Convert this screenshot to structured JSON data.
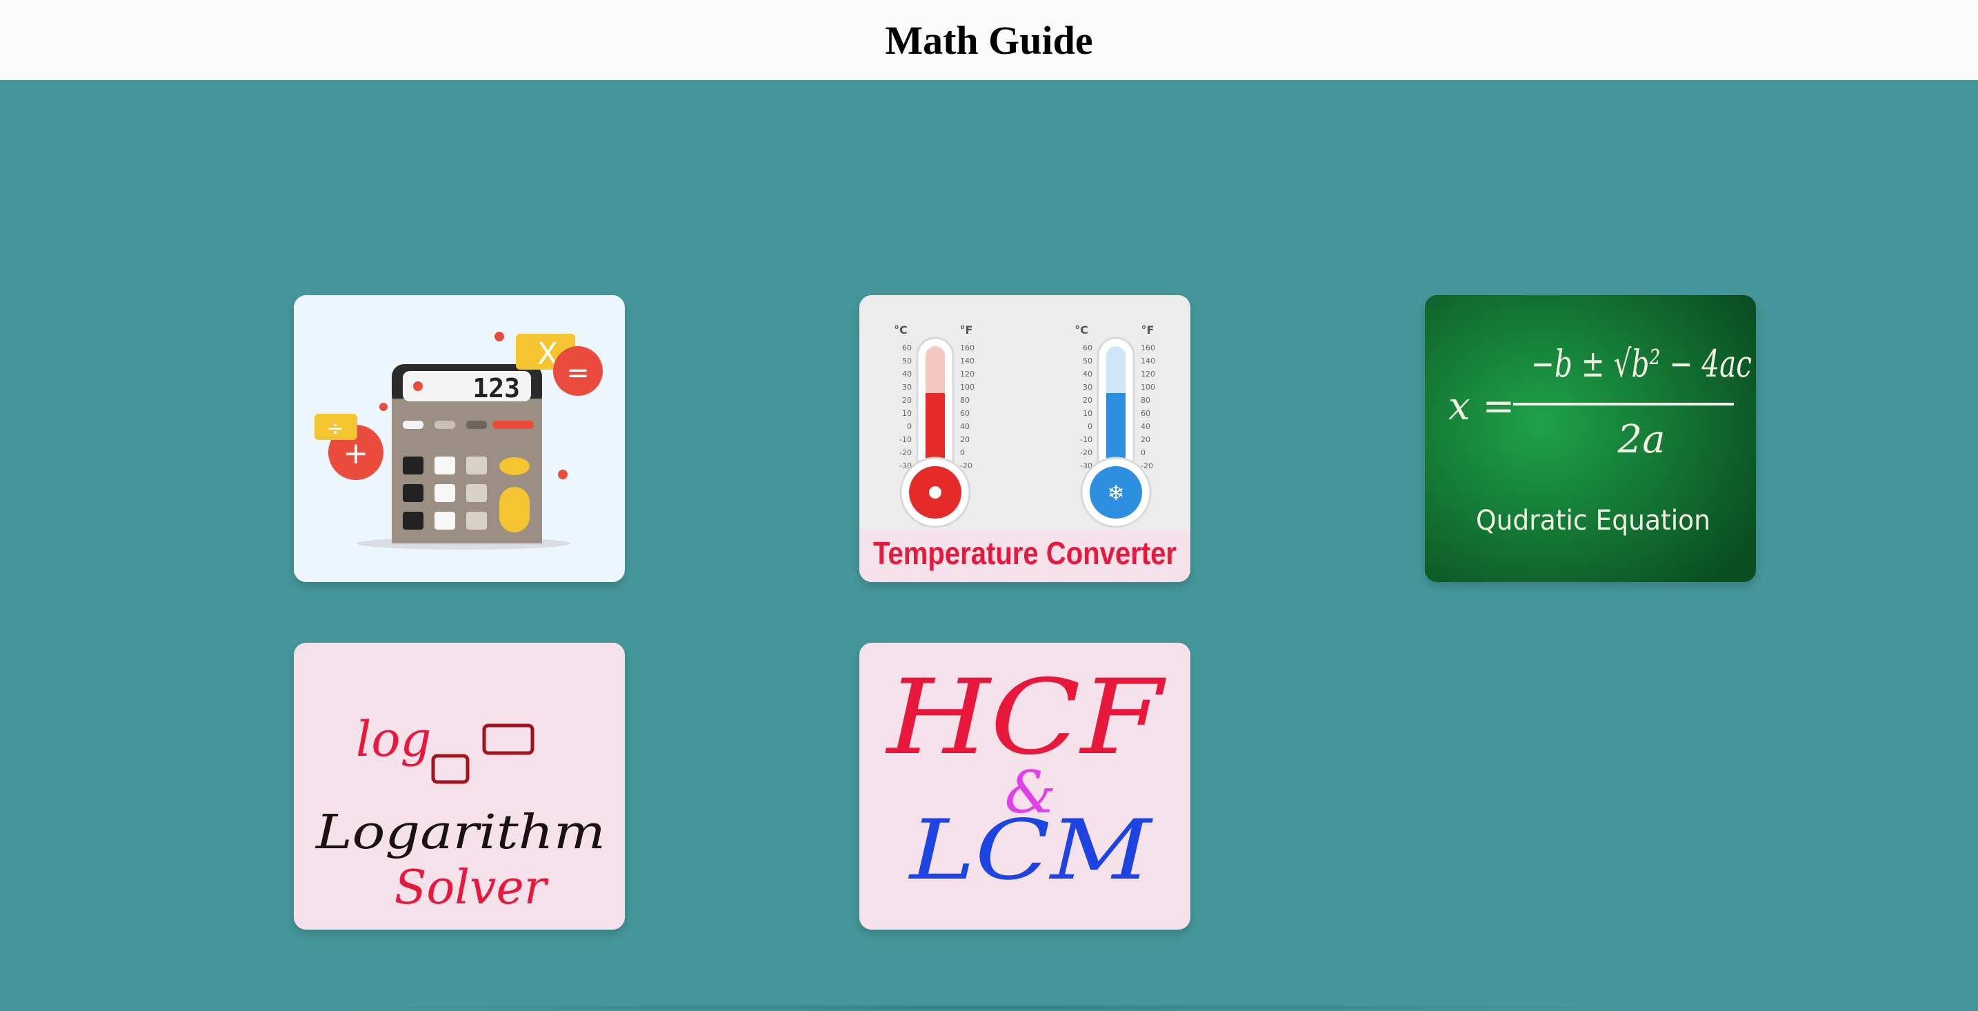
{
  "header": {
    "title": "Math Guide"
  },
  "cards": [
    {
      "label": ""
    },
    {
      "label": "Temperature Converter",
      "celsius": "°C",
      "fahrenheit": "°F",
      "c_ticks": [
        "60",
        "50",
        "40",
        "30",
        "20",
        "10",
        "0",
        "-10",
        "-20",
        "-30"
      ],
      "f_ticks": [
        "160",
        "140",
        "120",
        "100",
        "80",
        "60",
        "40",
        "20",
        "0",
        "-20"
      ]
    },
    {
      "label": "Qudratic Equation",
      "x": "x =",
      "numerator": "−b ± √b² − 4ac",
      "denominator": "2a"
    },
    {
      "label_top": "Logarithm",
      "label_bottom": "Solver",
      "log": "log"
    },
    {
      "top": "HCF",
      "mid": "&",
      "bottom": "LCM"
    }
  ],
  "calculator": {
    "display": "123"
  },
  "colors": {
    "page_bg": "#45979b",
    "header_bg": "#fafafa",
    "card_pink": "#f5e1ea",
    "board_green": "#0c5e2a"
  }
}
